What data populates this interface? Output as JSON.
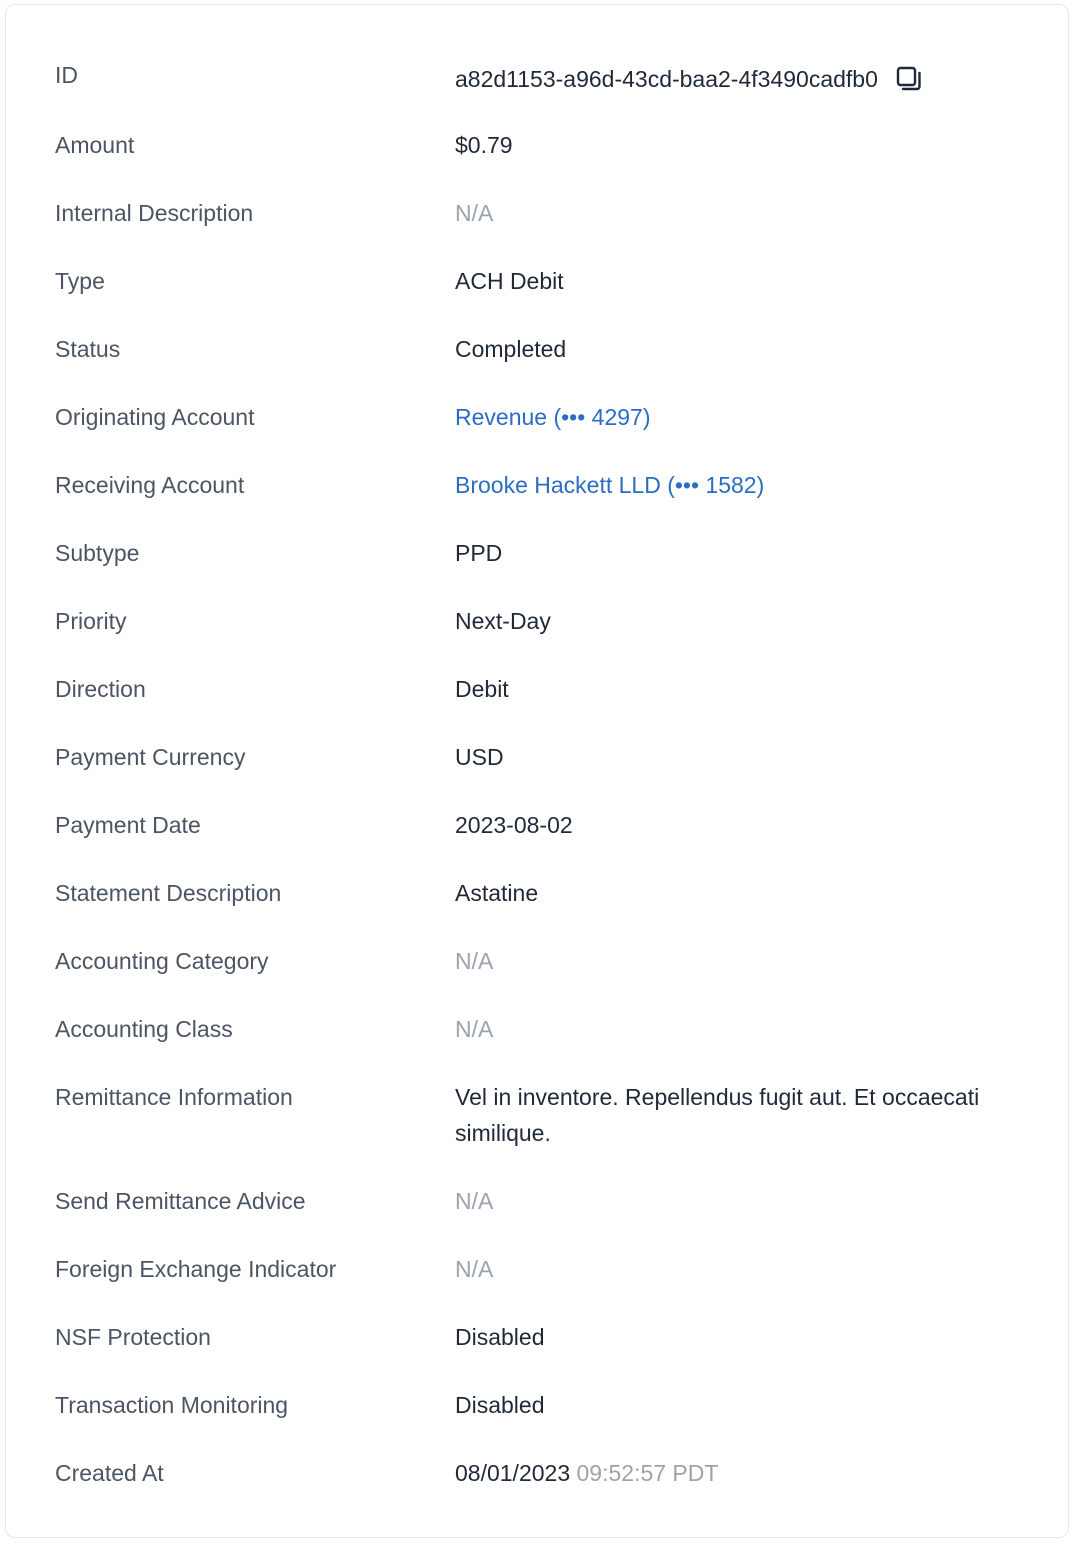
{
  "fields": [
    {
      "label": "ID",
      "value": "a82d1153-a96d-43cd-baa2-4f3490cadfb0"
    },
    {
      "label": "Amount",
      "value": "$0.79"
    },
    {
      "label": "Internal Description",
      "value": "N/A"
    },
    {
      "label": "Type",
      "value": "ACH Debit"
    },
    {
      "label": "Status",
      "value": "Completed"
    },
    {
      "label": "Originating Account",
      "value": "Revenue (••• 4297)"
    },
    {
      "label": "Receiving Account",
      "value": "Brooke Hackett LLD (••• 1582)"
    },
    {
      "label": "Subtype",
      "value": "PPD"
    },
    {
      "label": "Priority",
      "value": "Next-Day"
    },
    {
      "label": "Direction",
      "value": "Debit"
    },
    {
      "label": "Payment Currency",
      "value": "USD"
    },
    {
      "label": "Payment Date",
      "value": "2023-08-02"
    },
    {
      "label": "Statement Description",
      "value": "Astatine"
    },
    {
      "label": "Accounting Category",
      "value": "N/A"
    },
    {
      "label": "Accounting Class",
      "value": "N/A"
    },
    {
      "label": "Remittance Information",
      "value": "Vel in inventore. Repellendus fugit aut. Et occaecati similique."
    },
    {
      "label": "Send Remittance Advice",
      "value": "N/A"
    },
    {
      "label": "Foreign Exchange Indicator",
      "value": "N/A"
    },
    {
      "label": "NSF Protection",
      "value": "Disabled"
    },
    {
      "label": "Transaction Monitoring",
      "value": "Disabled"
    },
    {
      "label": "Created At",
      "value": "08/01/2023",
      "time": "09:52:57 PDT"
    }
  ],
  "icons": {
    "copy": "copy-icon"
  },
  "colors": {
    "link": "#2b6cc4",
    "muted": "#9ca3af",
    "label": "#4b5563",
    "value": "#1f2937"
  }
}
